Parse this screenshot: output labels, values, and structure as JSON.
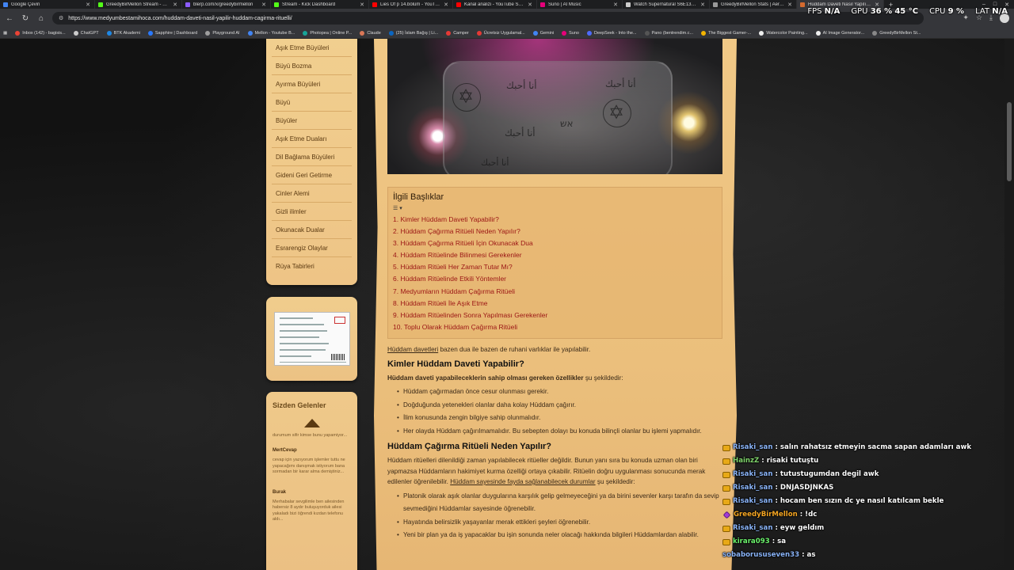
{
  "browser": {
    "tabs": [
      {
        "label": "Google Çeviri",
        "color": "#4285f4",
        "active": false
      },
      {
        "label": "GreedyBirMellon Stream - Watc...",
        "color": "#53fc18",
        "active": false
      },
      {
        "label": "blerp.com/x/greedybirmellon",
        "color": "#8c5cff",
        "active": false
      },
      {
        "label": "Stream - Kick Dashboard",
        "color": "#53fc18",
        "active": false
      },
      {
        "label": "Lies Of p 14.bölüm - YouTube",
        "color": "#ff0000",
        "active": false
      },
      {
        "label": "Kanal analizi - YouTube Studio",
        "color": "#ff0000",
        "active": false
      },
      {
        "label": "Suno | AI Music",
        "color": "#e6007a",
        "active": false
      },
      {
        "label": "Watch Supernatural S6E13 onli...",
        "color": "#cccccc",
        "active": false
      },
      {
        "label": "GreedyBirMellon Stats | AeroKi...",
        "color": "#999999",
        "active": false
      },
      {
        "label": "Hüddam Daveti Nasıl Yapılır? H...",
        "color": "#d46a2f",
        "active": true
      }
    ],
    "url": "https://www.medyumbestamihoca.com/huddam-daveti-nasil-yapilir-huddam-cagirma-rituelli/",
    "bookmarks": [
      {
        "label": "Inbox (142) - bagisis...",
        "color": "#ea4335"
      },
      {
        "label": "ChatGPT",
        "color": "#cccccc"
      },
      {
        "label": "BTK Akademi",
        "color": "#1e88e5"
      },
      {
        "label": "Sapphire | Dashboard",
        "color": "#2979ff"
      },
      {
        "label": "Playground AI",
        "color": "#9e9e9e"
      },
      {
        "label": "Mellon - Youtube B...",
        "color": "#4285f4"
      },
      {
        "label": "Photopea | Online P...",
        "color": "#18a497"
      },
      {
        "label": "Claude",
        "color": "#d97757"
      },
      {
        "label": "(25) İslam Bağış | Li...",
        "color": "#0a66c2"
      },
      {
        "label": "Camper",
        "color": "#e53935"
      },
      {
        "label": "Ücretsiz Uygulamal...",
        "color": "#e53935"
      },
      {
        "label": "Gemini",
        "color": "#4285f4"
      },
      {
        "label": "Suno",
        "color": "#e6007a"
      },
      {
        "label": "DeepSeek - Into the...",
        "color": "#4d6bfe"
      },
      {
        "label": "Pano (bentrendim.c...",
        "color": "#555555"
      },
      {
        "label": "The Biggest Gamer-...",
        "color": "#f4b400"
      },
      {
        "label": "Watercolor Painting...",
        "color": "#eeeeee"
      },
      {
        "label": "AI Image Generator...",
        "color": "#eeeeee"
      },
      {
        "label": "GreedyBirMellon St...",
        "color": "#888888"
      }
    ]
  },
  "hud": {
    "fps_label": "FPS",
    "fps_value": "N/A",
    "gpu_label": "GPU",
    "gpu_value": "36 %",
    "gpu_temp": "45 °C",
    "cpu_label": "CPU",
    "cpu_value": "9 %",
    "lat_label": "LAT",
    "lat_value": "N/A"
  },
  "sidebar": {
    "menu": [
      "Aşık Etme Büyüleri",
      "Büyü Bozma",
      "Ayırma Büyüleri",
      "Büyü",
      "Büyüler",
      "Aşık Etme Duaları",
      "Dil Bağlama Büyüleri",
      "Gideni Geri Getirme",
      "Cinler Alemi",
      "Gizli ilimler",
      "Okunacak Dualar",
      "Esrarengiz Olaylar",
      "Rüya Tabirleri"
    ],
    "testimonials": {
      "title": "Sizden Gelenler",
      "note": "durumum sifir kimse bunu yapamiyor...",
      "items": [
        {
          "author": "MertCevap",
          "text": "cevap için yazıyorum işlemler tuttu ne yapacağımı danışmak istiyorum bana sormadan bir karar alma demiştiniz..."
        },
        {
          "author": "Burak",
          "text": "Merhabalar sevgilimle ben ailesinden habersiz 8 aydır buluşuyorduk ailesi yakaladı bizi öğrendi kızdan telefonu aldı..."
        }
      ]
    }
  },
  "article": {
    "hero_text": [
      "أنا أحبك",
      "أنا أحبك",
      "אש",
      "أنا أحبك",
      "أنا أحبك"
    ],
    "toc": {
      "title": "İlgili Başlıklar",
      "toggle": "☰ ▾",
      "items": [
        "1. Kimler Hüddam Daveti Yapabilir?",
        "2. Hüddam Çağırma Ritüeli Neden Yapılır?",
        "3. Hüddam Çağırma Ritüeli İçin Okunacak Dua",
        "4. Hüddam Ritüelinde Bilinmesi Gerekenler",
        "5. Hüddam Ritüeli Her Zaman Tutar Mı?",
        "6. Hüddam Ritüelinde Etkili Yöntemler",
        "7. Medyumların Hüddam Çağırma Ritüeli",
        "8. Hüddam Ritüeli İle Aşık Etme",
        "9. Hüddam Ritüelinden Sonra Yapılması Gerekenler",
        "10. Toplu Olarak Hüddam Çağırma Ritüeli"
      ]
    },
    "intro_link": "Hüddam davetleri",
    "intro_rest": " bazen dua ile bazen de ruhani varlıklar ile yapılabilir.",
    "h2_1": "Kimler Hüddam Daveti Yapabilir?",
    "p1_bold": "Hüddam daveti yapabileceklerin sahip olması gereken özellikler",
    "p1_rest": " şu şekildedir:",
    "list1": [
      "Hüddam çağırmadan önce cesur olunması gerekir.",
      "Doğduğunda yetenekleri olanlar daha kolay Hüddam çağırır.",
      "İlim konusunda zengin bilgiye sahip olunmalıdır.",
      "Her olayda Hüddam çağırılmamalıdır. Bu sebepten dolayı bu konuda bilinçli olanlar bu işlemi yapmalıdır."
    ],
    "h2_2": "Hüddam Çağırma Ritüeli Neden Yapılır?",
    "p2_a": "Hüddam ritüelleri dilenildiği zaman yapılabilecek ritüeller değildir. Bunun yanı sıra bu konuda uzman olan biri yapmazsa Hüddamların hakimiyet kurma özelliği ortaya çıkabilir. Ritüelin doğru uygulanması sonucunda merak edilenler öğrenilebilir. ",
    "p2_link": "Hüddam sayesinde fayda sağlanabilecek durumlar",
    "p2_b": " şu şekildedir:",
    "list2": [
      "Platonik olarak aşık olanlar duygularına karşılık gelip gelmeyeceğini ya da birini sevenler karşı tarafın da sevip sevmediğini Hüddamlar sayesinde öğrenebilir.",
      "Hayatında belirsizlik yaşayanlar merak ettikleri şeyleri öğrenebilir.",
      "Yeni bir plan ya da iş yapacaklar bu işin sonunda neler olacağı hakkında bilgileri Hüddamlardan alabilir."
    ]
  },
  "chat": [
    {
      "user": "Risaki_san",
      "color": "#8ab4f8",
      "badge": "sub",
      "msg": "salın rahatsız etmeyin sacma sapan adamları awk"
    },
    {
      "user": "HainzZ",
      "color": "#7fd36b",
      "badge": "sub",
      "msg": "risaki tutuştu"
    },
    {
      "user": "Risaki_san",
      "color": "#8ab4f8",
      "badge": "sub",
      "msg": "tutustugumdan degil awk"
    },
    {
      "user": "Risaki_san",
      "color": "#8ab4f8",
      "badge": "sub",
      "msg": "DNJASDJNKAS"
    },
    {
      "user": "Risaki_san",
      "color": "#8ab4f8",
      "badge": "sub",
      "msg": "hocam ben sızın dc ye nasıl katılcam bekle"
    },
    {
      "user": "GreedyBirMellon",
      "color": "#f5a623",
      "badge": "mod",
      "msg": "!dc"
    },
    {
      "user": "Risaki_san",
      "color": "#8ab4f8",
      "badge": "sub",
      "msg": "eyw geldım"
    },
    {
      "user": "kirara093",
      "color": "#6cf26c",
      "badge": "sub",
      "msg": "sa"
    },
    {
      "user": "sobaborususeven33",
      "color": "#8ab4f8",
      "badge": "none",
      "msg": "as"
    }
  ]
}
